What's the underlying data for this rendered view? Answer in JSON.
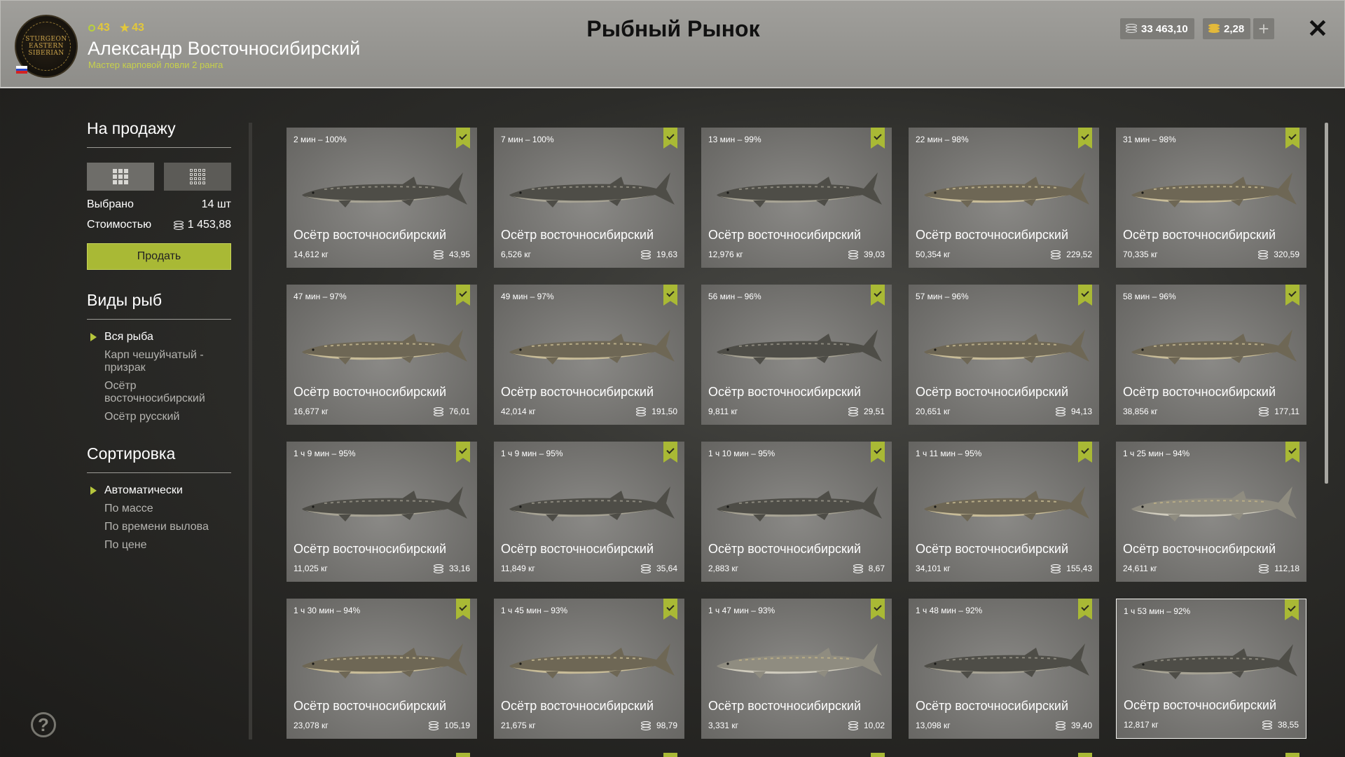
{
  "header": {
    "title": "Рыбный Рынок",
    "player_name": "Александр Восточносибирский",
    "player_rank": "Мастер карповой ловли 2 ранга",
    "level": "43",
    "stars": "43",
    "avatar_text": "STURGEON EASTERN SIBERIAN",
    "silver": "33 463,10",
    "gold": "2,28",
    "plus": "+",
    "close": "✕"
  },
  "sidebar": {
    "for_sale_title": "На продажу",
    "selected_label": "Выбрано",
    "selected_value": "14 шт",
    "cost_label": "Стоимостью",
    "cost_value": "1 453,88",
    "sell_button": "Продать",
    "species_title": "Виды рыб",
    "species": [
      "Вся рыба",
      "Карп чешуйчатый - призрак",
      "Осётр восточносибирский",
      "Осётр русский"
    ],
    "species_active": 0,
    "sort_title": "Сортировка",
    "sort": [
      "Автоматически",
      "По массе",
      "По времени вылова",
      "По цене"
    ],
    "sort_active": 0,
    "help": "?"
  },
  "colors": {
    "accent": "#a9b935",
    "card_bg": "#7a7976"
  },
  "fish_cards": [
    {
      "time": "2 мин – 100%",
      "name": "Осётр восточносибирский",
      "weight": "14,612 кг",
      "price": "43,95",
      "tone": "dark"
    },
    {
      "time": "7 мин – 100%",
      "name": "Осётр восточносибирский",
      "weight": "6,526 кг",
      "price": "19,63",
      "tone": "dark"
    },
    {
      "time": "13 мин – 99%",
      "name": "Осётр восточносибирский",
      "weight": "12,976 кг",
      "price": "39,03",
      "tone": "dark"
    },
    {
      "time": "22 мин – 98%",
      "name": "Осётр восточносибирский",
      "weight": "50,354 кг",
      "price": "229,52",
      "tone": "light"
    },
    {
      "time": "31 мин – 98%",
      "name": "Осётр восточносибирский",
      "weight": "70,335 кг",
      "price": "320,59",
      "tone": "light"
    },
    {
      "time": "47 мин – 97%",
      "name": "Осётр восточносибирский",
      "weight": "16,677 кг",
      "price": "76,01",
      "tone": "light"
    },
    {
      "time": "49 мин – 97%",
      "name": "Осётр восточносибирский",
      "weight": "42,014 кг",
      "price": "191,50",
      "tone": "light"
    },
    {
      "time": "56 мин – 96%",
      "name": "Осётр восточносибирский",
      "weight": "9,811 кг",
      "price": "29,51",
      "tone": "dark"
    },
    {
      "time": "57 мин – 96%",
      "name": "Осётр восточносибирский",
      "weight": "20,651 кг",
      "price": "94,13",
      "tone": "light"
    },
    {
      "time": "58 мин – 96%",
      "name": "Осётр восточносибирский",
      "weight": "38,856 кг",
      "price": "177,11",
      "tone": "light"
    },
    {
      "time": "1 ч 9 мин – 95%",
      "name": "Осётр восточносибирский",
      "weight": "11,025 кг",
      "price": "33,16",
      "tone": "dark"
    },
    {
      "time": "1 ч 9 мин – 95%",
      "name": "Осётр восточносибирский",
      "weight": "11,849 кг",
      "price": "35,64",
      "tone": "dark"
    },
    {
      "time": "1 ч 10 мин – 95%",
      "name": "Осётр восточносибирский",
      "weight": "2,883 кг",
      "price": "8,67",
      "tone": "dark"
    },
    {
      "time": "1 ч 11 мин – 95%",
      "name": "Осётр восточносибирский",
      "weight": "34,101 кг",
      "price": "155,43",
      "tone": "light"
    },
    {
      "time": "1 ч 25 мин – 94%",
      "name": "Осётр восточносибирский",
      "weight": "24,611 кг",
      "price": "112,18",
      "tone": "pale"
    },
    {
      "time": "1 ч 30 мин – 94%",
      "name": "Осётр восточносибирский",
      "weight": "23,078 кг",
      "price": "105,19",
      "tone": "light"
    },
    {
      "time": "1 ч 45 мин – 93%",
      "name": "Осётр восточносибирский",
      "weight": "21,675 кг",
      "price": "98,79",
      "tone": "light"
    },
    {
      "time": "1 ч 47 мин – 93%",
      "name": "Осётр восточносибирский",
      "weight": "3,331 кг",
      "price": "10,02",
      "tone": "pale"
    },
    {
      "time": "1 ч 48 мин – 92%",
      "name": "Осётр восточносибирский",
      "weight": "13,098 кг",
      "price": "39,40",
      "tone": "dark"
    },
    {
      "time": "1 ч 53 мин – 92%",
      "name": "Осётр восточносибирский",
      "weight": "12,817 кг",
      "price": "38,55",
      "tone": "dark",
      "selected": true
    }
  ]
}
